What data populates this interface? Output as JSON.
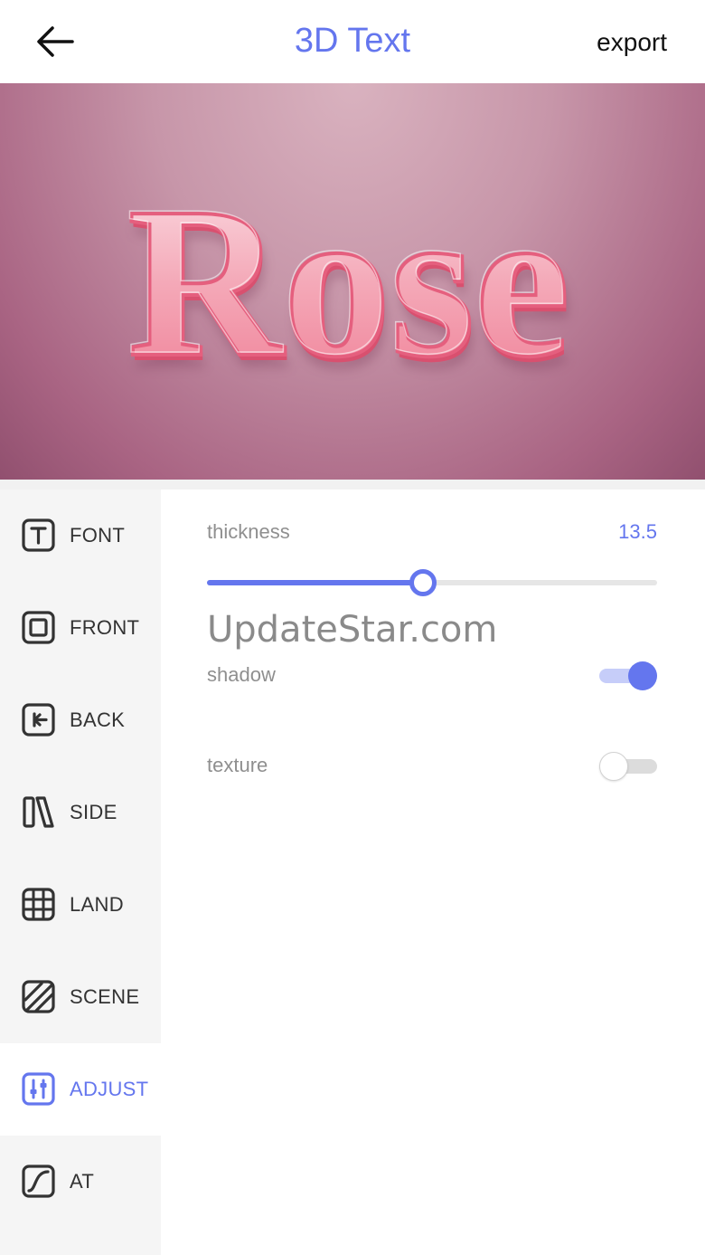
{
  "header": {
    "title": "3D Text",
    "export_label": "export"
  },
  "preview": {
    "text": "Rose"
  },
  "sidebar": {
    "items": [
      {
        "label": "FONT",
        "icon": "text-box-icon"
      },
      {
        "label": "FRONT",
        "icon": "square-frame-icon"
      },
      {
        "label": "BACK",
        "icon": "back-arrow-box-icon"
      },
      {
        "label": "SIDE",
        "icon": "side-panels-icon"
      },
      {
        "label": "LAND",
        "icon": "grid-icon"
      },
      {
        "label": "SCENE",
        "icon": "hatched-square-icon"
      },
      {
        "label": "ADJUST",
        "icon": "sliders-icon",
        "active": true
      },
      {
        "label": "AT",
        "icon": "curve-box-icon"
      }
    ]
  },
  "adjust": {
    "thickness": {
      "label": "thickness",
      "value": "13.5",
      "slider_fraction": 0.48
    },
    "watermark": "UpdateStar.com",
    "shadow": {
      "label": "shadow",
      "enabled": true
    },
    "texture": {
      "label": "texture",
      "enabled": false
    }
  },
  "colors": {
    "accent": "#6476ee",
    "sidebar_bg": "#f5f5f5",
    "label_gray": "#8f8f8f"
  }
}
